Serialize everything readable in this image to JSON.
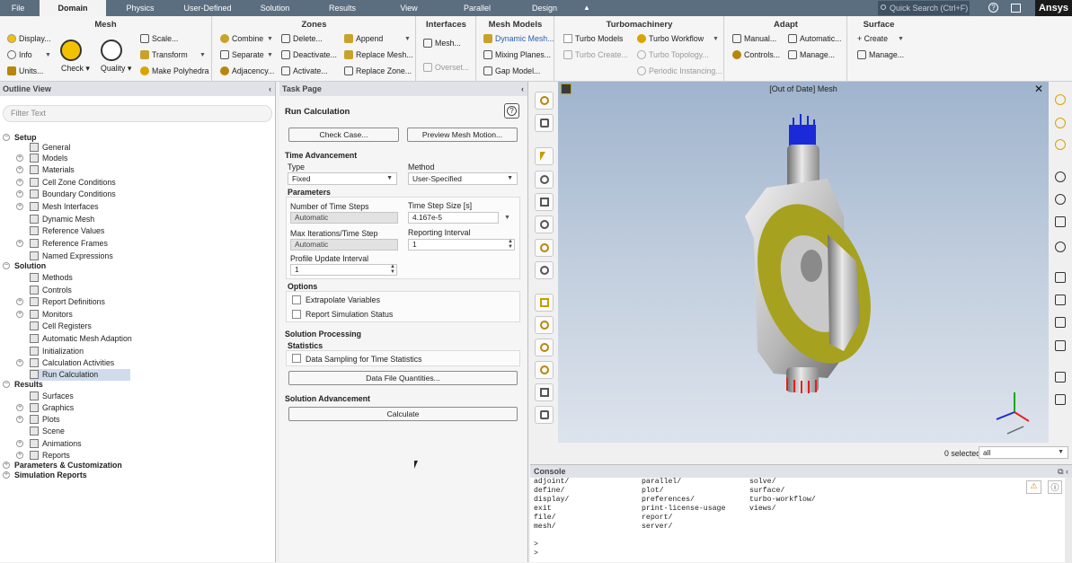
{
  "menu": {
    "tabs": [
      "File",
      "Domain",
      "Physics",
      "User-Defined",
      "Solution",
      "Results",
      "View",
      "Parallel",
      "Design"
    ],
    "search_placeholder": "Quick Search (Ctrl+F)",
    "brand": "Ansys",
    "help": "?"
  },
  "ribbon": {
    "mesh": {
      "title": "Mesh",
      "display": "Display...",
      "info": "Info",
      "units": "Units...",
      "check": "Check",
      "quality": "Quality",
      "scale": "Scale...",
      "transform": "Transform",
      "make_polyhedra": "Make Polyhedra"
    },
    "zones": {
      "title": "Zones",
      "combine": "Combine",
      "separate": "Separate",
      "adjacency": "Adjacency...",
      "delete": "Delete...",
      "deactivate": "Deactivate...",
      "activate": "Activate...",
      "append": "Append",
      "replace_mesh": "Replace Mesh...",
      "replace_zone": "Replace Zone..."
    },
    "interfaces": {
      "title": "Interfaces",
      "mesh": "Mesh...",
      "overset": "Overset..."
    },
    "mesh_models": {
      "title": "Mesh Models",
      "dynamic_mesh": "Dynamic Mesh...",
      "mixing_planes": "Mixing Planes...",
      "gap_model": "Gap Model..."
    },
    "turbomachinery": {
      "title": "Turbomachinery",
      "turbo_models": "Turbo Models",
      "turbo_workflow": "Turbo Workflow",
      "turbo_create": "Turbo Create...",
      "turbo_topology": "Turbo Topology...",
      "periodic_instancing": "Periodic Instancing..."
    },
    "adapt": {
      "title": "Adapt",
      "manual": "Manual...",
      "automatic": "Automatic...",
      "controls": "Controls...",
      "manage": "Manage..."
    },
    "surface": {
      "title": "Surface",
      "create": "Create",
      "manage": "Manage..."
    }
  },
  "outline": {
    "title": "Outline View",
    "filter_placeholder": "Filter Text",
    "tree": [
      {
        "label": "Setup",
        "bold": true,
        "level": 0
      },
      {
        "label": "General",
        "level": 2
      },
      {
        "label": "Models",
        "level": 1
      },
      {
        "label": "Materials",
        "level": 1
      },
      {
        "label": "Cell Zone Conditions",
        "level": 1
      },
      {
        "label": "Boundary Conditions",
        "level": 1
      },
      {
        "label": "Mesh Interfaces",
        "level": 1
      },
      {
        "label": "Dynamic Mesh",
        "level": 2
      },
      {
        "label": "Reference Values",
        "level": 2
      },
      {
        "label": "Reference Frames",
        "level": 1
      },
      {
        "label": "Named Expressions",
        "level": 2
      },
      {
        "label": "Solution",
        "bold": true,
        "level": 0
      },
      {
        "label": "Methods",
        "level": 2
      },
      {
        "label": "Controls",
        "level": 2
      },
      {
        "label": "Report Definitions",
        "level": 1
      },
      {
        "label": "Monitors",
        "level": 1
      },
      {
        "label": "Cell Registers",
        "level": 2
      },
      {
        "label": "Automatic Mesh Adaption",
        "level": 2
      },
      {
        "label": "Initialization",
        "level": 2
      },
      {
        "label": "Calculation Activities",
        "level": 1
      },
      {
        "label": "Run Calculation",
        "level": 2,
        "selected": true
      },
      {
        "label": "Results",
        "bold": true,
        "level": 0
      },
      {
        "label": "Surfaces",
        "level": 2
      },
      {
        "label": "Graphics",
        "level": 1
      },
      {
        "label": "Plots",
        "level": 1
      },
      {
        "label": "Scene",
        "level": 2
      },
      {
        "label": "Animations",
        "level": 1
      },
      {
        "label": "Reports",
        "level": 1
      },
      {
        "label": "Parameters & Customization",
        "bold": true,
        "level": 0
      },
      {
        "label": "Simulation Reports",
        "bold": true,
        "level": 0
      }
    ]
  },
  "task": {
    "header": "Task Page",
    "title": "Run Calculation",
    "check_case": "Check Case...",
    "preview_mesh_motion": "Preview Mesh Motion...",
    "time_advancement": "Time Advancement",
    "type_label": "Type",
    "type_value": "Fixed",
    "method_label": "Method",
    "method_value": "User-Specified",
    "parameters": "Parameters",
    "num_steps_label": "Number of Time Steps",
    "num_steps_value": "Automatic",
    "step_size_label": "Time Step Size [s]",
    "step_size_value": "4.167e-5",
    "max_iter_label": "Max Iterations/Time Step",
    "max_iter_value": "Automatic",
    "reporting_label": "Reporting Interval",
    "reporting_value": "1",
    "profile_label": "Profile Update Interval",
    "profile_value": "1",
    "options": "Options",
    "extrapolate": "Extrapolate Variables",
    "report_status": "Report Simulation Status",
    "solution_processing": "Solution Processing",
    "statistics": "Statistics",
    "data_sampling": "Data Sampling for Time Statistics",
    "data_file_quantities": "Data File Quantities...",
    "solution_advancement": "Solution Advancement",
    "calculate": "Calculate"
  },
  "viewport": {
    "title": "[Out of Date] Mesh",
    "close": "✕",
    "selected_text": "0 selected",
    "selection_filter": "all"
  },
  "console": {
    "title": "Console",
    "col1": [
      "adjoint/",
      "define/",
      "display/",
      "exit",
      "file/",
      "mesh/"
    ],
    "col2": [
      "parallel/",
      "plot/",
      "preferences/",
      "print-license-usage",
      "report/",
      "server/"
    ],
    "col3": [
      "solve/",
      "surface/",
      "turbo-workflow/",
      "views/"
    ],
    "prompts": [
      ">",
      ">"
    ]
  },
  "colors": {
    "menubar": "#5a6e80",
    "accent": "#f2c200",
    "model_yellow": "#a6a21f",
    "selection": "#cfdcec"
  }
}
